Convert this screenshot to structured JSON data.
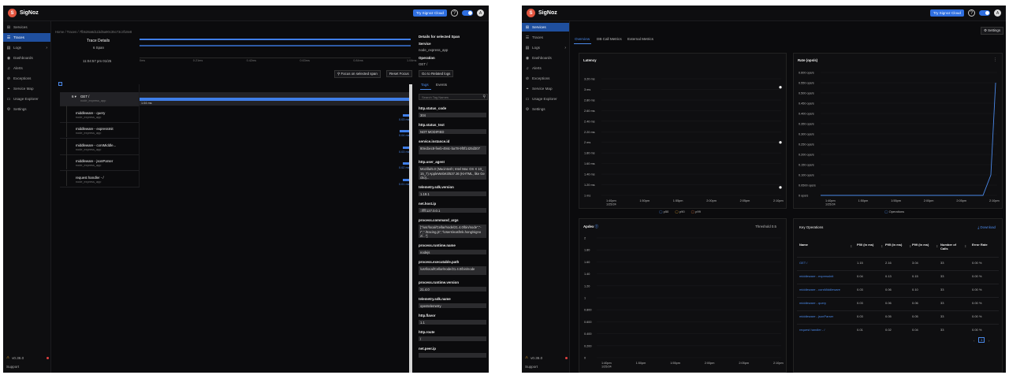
{
  "app": {
    "brand": "SigNoz",
    "logo_letter": "S",
    "cloud_button": "Try Signoz Cloud",
    "help": "?",
    "avatar": "A",
    "version": "v0.36.0",
    "support": "Support",
    "nav": [
      {
        "label": "Services",
        "icon": "services-icon"
      },
      {
        "label": "Traces",
        "icon": "traces-icon"
      },
      {
        "label": "Logs",
        "icon": "logs-icon"
      },
      {
        "label": "Dashboards",
        "icon": "dashboards-icon"
      },
      {
        "label": "Alerts",
        "icon": "alerts-icon"
      },
      {
        "label": "Exceptions",
        "icon": "exceptions-icon"
      },
      {
        "label": "Service Map",
        "icon": "service-map-icon"
      },
      {
        "label": "Usage Explorer",
        "icon": "usage-icon"
      },
      {
        "label": "Settings",
        "icon": "settings-icon"
      }
    ],
    "accent": "#2f6fe0"
  },
  "trace": {
    "breadcrumb": "Home / Traces / 7fb528a6d11bd5a90c35c73c3f18e8",
    "title": "Trace Details",
    "spans": "6 Span",
    "timestamp": "11:04:57 pm 01/25",
    "ticks": [
      "0ms",
      "0.21ms",
      "0.42ms",
      "0.63ms",
      "0.84ms",
      "1.04ms"
    ],
    "focus_button": "Focus on selected span",
    "reset_button": "Reset Focus",
    "rows": [
      {
        "name": "GET /",
        "service": "node_express_app",
        "duration": "1.04 ms",
        "fill": 1.0,
        "count": "6"
      },
      {
        "name": "middleware - query",
        "service": "node_express_app",
        "duration": "0.03 ms",
        "fill": 0.03
      },
      {
        "name": "middleware - expressInit",
        "service": "node_express_app",
        "duration": "0.04 ms",
        "fill": 0.04
      },
      {
        "name": "middleware - corsMiddle...",
        "service": "node_express_app",
        "duration": "0.03 ms",
        "fill": 0.03
      },
      {
        "name": "middleware - jsonParser",
        "service": "node_express_app",
        "duration": "0.02 ms",
        "fill": 0.02
      },
      {
        "name": "request handler - /",
        "service": "node_express_app",
        "duration": "0.01 ms",
        "fill": 0.01
      }
    ],
    "detail": {
      "header": "Details for selected Span",
      "service_label": "Service",
      "service_value": "node_express_app",
      "operation_label": "Operation",
      "operation_value": "GET /",
      "related_logs": "Go to Related logs",
      "tab_tags": "Tags",
      "tab_events": "Events",
      "search_placeholder": "Search Tag Names",
      "tags": [
        {
          "key": "http.status_code",
          "value": "304"
        },
        {
          "key": "http.status_text",
          "value": "NOT MODIFIED"
        },
        {
          "key": "service.instance.id",
          "value": "80ecbec8-feeb-494c-ba78-9f0f1425d307"
        },
        {
          "key": "http.user_agent",
          "value": "Mozilla/5.0 (Macintosh; Intel Mac OS X 10_15_7) AppleWebKit/537.36 (KHTML, like Gecko)..."
        },
        {
          "key": "telemetry.sdk.version",
          "value": "1.19.1"
        },
        {
          "key": "net.host.ip",
          "value": "::ffff:127.0.0.1"
        },
        {
          "key": "process.command_args",
          "value": "[\"/usr/local/Cellar/node/21.4.0/bin/node\",\"-r\",\"./tracing.js\",\"/Users/easfmk.hong/signoz/...\"]"
        },
        {
          "key": "process.runtime.name",
          "value": "nodejs"
        },
        {
          "key": "process.executable.path",
          "value": "/usr/local/Cellar/node/21.4.0/bin/node"
        },
        {
          "key": "process.runtime.version",
          "value": "21.4.0"
        },
        {
          "key": "telemetry.sdk.name",
          "value": "opentelemetry"
        },
        {
          "key": "http.flavor",
          "value": "1.1"
        },
        {
          "key": "http.route",
          "value": "/"
        },
        {
          "key": "net.peer.ip",
          "value": ""
        }
      ]
    }
  },
  "service": {
    "settings_button": "Settings",
    "tabs": [
      "Overview",
      "DB Call Metrics",
      "External Metrics"
    ],
    "latency": {
      "title": "Latency",
      "yticks": [
        "3.20 ms",
        "3 ms",
        "2.80 ms",
        "2.60 ms",
        "2.40 ms",
        "2.20 ms",
        "2 ms",
        "1.80 ms",
        "1.60 ms",
        "1.40 ms",
        "1.20 ms",
        "1 ms"
      ],
      "xticks": [
        "1:40pm\n1/25/24",
        "1:50pm",
        "1:55pm",
        "2:00pm",
        "2:05pm",
        "2:10pm"
      ],
      "legend": [
        "p50",
        "p90",
        "p99"
      ]
    },
    "rate": {
      "title": "Rate (ops/s)",
      "yticks": [
        "0.600 ops/s",
        "0.550 ops/s",
        "0.500 ops/s",
        "0.450 ops/s",
        "0.400 ops/s",
        "0.350 ops/s",
        "0.300 ops/s",
        "0.250 ops/s",
        "0.200 ops/s",
        "0.150 ops/s",
        "0.100 ops/s",
        "0.0500 ops/s",
        "0 ops/s"
      ],
      "xticks": [
        "1:40pm\n1/25/24",
        "1:50pm",
        "1:55pm",
        "2:00pm",
        "2:05pm",
        "2:10pm"
      ],
      "legend": "Operations"
    },
    "apdex": {
      "title": "Apdex",
      "threshold": "Threshold 0.5",
      "yticks": [
        "2",
        "1.80",
        "1.60",
        "1.40",
        "1.20",
        "1",
        "0.800",
        "0.600",
        "0.400",
        "0.200",
        "0"
      ],
      "xticks": [
        "1:40pm\n1/25/24",
        "1:50pm",
        "1:55pm",
        "2:00pm",
        "2:05pm",
        "2:10pm"
      ]
    },
    "key_ops": {
      "title": "Key Operations",
      "download": "Download",
      "columns": [
        "Name",
        "P50 (in ms)",
        "P95 (in ms)",
        "P99 (in ms)",
        "Number of Calls",
        "Error Rate"
      ],
      "rows": [
        [
          "GET /",
          "1.15",
          "2.16",
          "3.04",
          "33",
          "0.00 %"
        ],
        [
          "middleware - expressInit",
          "0.04",
          "0.13",
          "0.15",
          "33",
          "0.00 %"
        ],
        [
          "middleware - corsMiddleware",
          "0.03",
          "0.06",
          "0.10",
          "33",
          "0.00 %"
        ],
        [
          "middleware - query",
          "0.03",
          "0.06",
          "0.06",
          "33",
          "0.00 %"
        ],
        [
          "middleware - jsonParser",
          "0.03",
          "0.05",
          "0.05",
          "33",
          "0.00 %"
        ],
        [
          "request handler - /",
          "0.01",
          "0.02",
          "0.04",
          "33",
          "0.00 %"
        ]
      ],
      "page": "1"
    }
  }
}
